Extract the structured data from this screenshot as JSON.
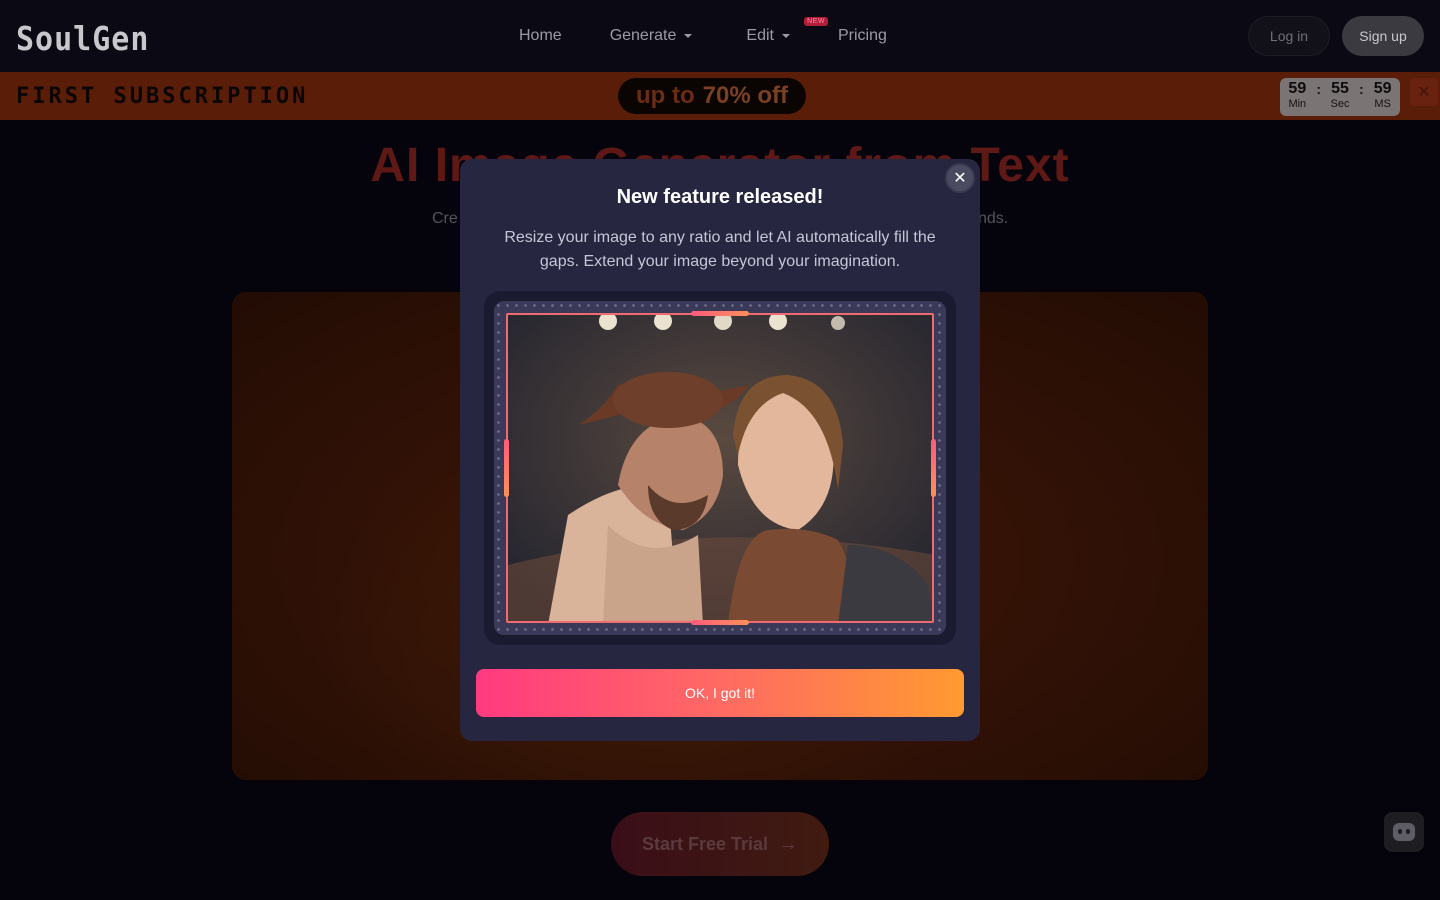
{
  "nav": {
    "logo": "SoulGen",
    "links": [
      {
        "label": "Home"
      },
      {
        "label": "Generate"
      },
      {
        "label": "Edit",
        "badge": "NEW"
      },
      {
        "label": "Pricing"
      }
    ],
    "login_label": "Log in",
    "signup_label": "Sign up"
  },
  "promo": {
    "title": "FIRST SUBSCRIPTION",
    "offer_prefix": "up to",
    "offer_value": "70% off",
    "countdown": [
      {
        "value": "59",
        "label": "Min"
      },
      {
        "value": "55",
        "label": "Sec"
      },
      {
        "value": "59",
        "label": "MS"
      }
    ],
    "separator": ":",
    "close_icon": "close-icon"
  },
  "hero": {
    "title": "AI Image Generator from Text",
    "subtitle_start": "Cre",
    "subtitle_end": "nds.",
    "trial_label": "Start Free Trial",
    "trial_arrow": "→"
  },
  "modal": {
    "close_glyph": "✕",
    "title": "New feature released!",
    "description": "Resize your image to any ratio and let AI automatically fill the gaps. Extend your image beyond your imagination.",
    "ok_label": "OK, I got it!"
  },
  "colors": {
    "accent_start": "#ff3a80",
    "accent_end": "#ff9a30",
    "modal_bg": "#262641"
  }
}
